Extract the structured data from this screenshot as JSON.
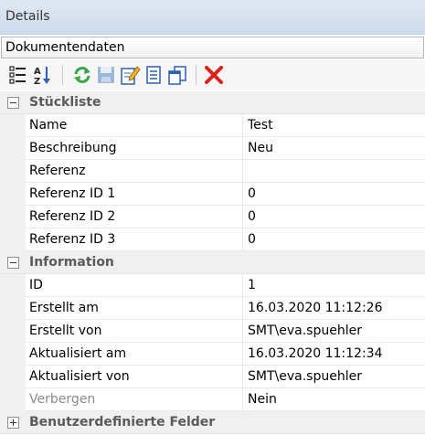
{
  "panel": {
    "title": "Details"
  },
  "selector": {
    "selected": "Dokumentendaten"
  },
  "toolbar": {
    "buttons": [
      {
        "icon": "categorized-icon"
      },
      {
        "icon": "sort-az-icon"
      },
      {
        "icon": "refresh-icon"
      },
      {
        "icon": "save-icon"
      },
      {
        "icon": "edit-icon"
      },
      {
        "icon": "document-icon"
      },
      {
        "icon": "copy-document-icon"
      },
      {
        "icon": "delete-icon"
      }
    ]
  },
  "grid": {
    "categories": [
      {
        "label": "Stückliste",
        "expanded": true,
        "rows": [
          {
            "name": "Name",
            "value": "Test"
          },
          {
            "name": "Beschreibung",
            "value": "Neu"
          },
          {
            "name": "Referenz",
            "value": ""
          },
          {
            "name": "Referenz ID 1",
            "value": "0"
          },
          {
            "name": "Referenz ID 2",
            "value": "0"
          },
          {
            "name": "Referenz ID 3",
            "value": "0"
          }
        ]
      },
      {
        "label": "Information",
        "expanded": true,
        "rows": [
          {
            "name": "ID",
            "value": "1"
          },
          {
            "name": "Erstellt am",
            "value": "16.03.2020 11:12:26"
          },
          {
            "name": "Erstellt von",
            "value": "SMT\\eva.spuehler"
          },
          {
            "name": "Aktualisiert am",
            "value": "16.03.2020 11:12:34"
          },
          {
            "name": "Aktualisiert von",
            "value": "SMT\\eva.spuehler"
          },
          {
            "name": "Verbergen",
            "value": "Nein",
            "disabled": true
          }
        ]
      },
      {
        "label": "Benutzerdefinierte Felder",
        "expanded": false,
        "rows": []
      }
    ]
  },
  "colors": {
    "title_bar": "#cfdcec",
    "category_bg": "#f0f0f0",
    "grid_line": "#e8e8e8",
    "delete_red": "#e0201a",
    "refresh_green": "#3aa84a",
    "toolbar_blue": "#2c5fb8"
  }
}
